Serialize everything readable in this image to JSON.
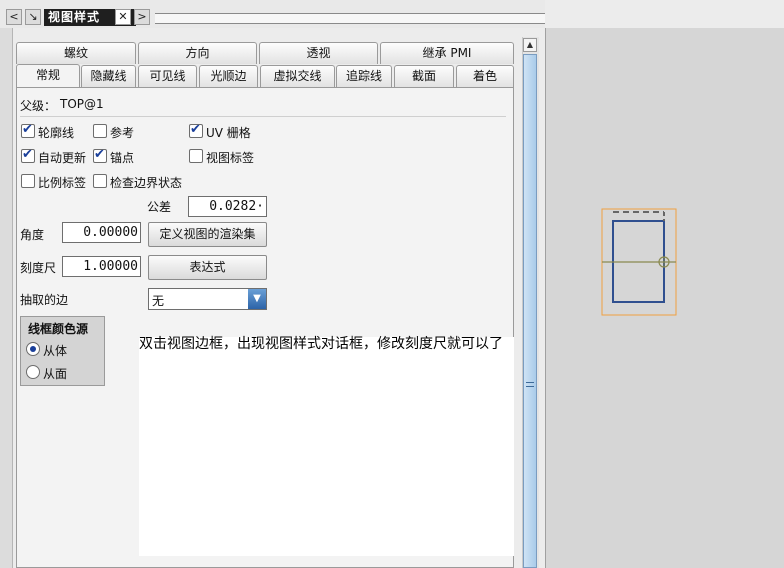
{
  "titlebar": {
    "title": "视图样式",
    "nav_left": "<",
    "nav_right": ">",
    "close": "✕",
    "pin": "↘"
  },
  "tabs_row1": [
    "螺纹",
    "方向",
    "透视",
    "继承 PMI"
  ],
  "tabs_row2": [
    "常规",
    "隐藏线",
    "可见线",
    "光顺边",
    "虚拟交线",
    "追踪线",
    "截面",
    "着色"
  ],
  "active_tab": "常规",
  "parent": {
    "label": "父级：",
    "value": "TOP@1"
  },
  "checkboxes": {
    "silhouette": {
      "label": "轮廓线",
      "checked": true
    },
    "reference": {
      "label": "参考",
      "checked": false
    },
    "uv_grid": {
      "label": "UV 栅格",
      "checked": true
    },
    "auto_update": {
      "label": "自动更新",
      "checked": true
    },
    "anchor": {
      "label": "锚点",
      "checked": true
    },
    "view_label": {
      "label": "视图标签",
      "checked": false
    },
    "scale_label": {
      "label": "比例标签",
      "checked": false
    },
    "check_boundary": {
      "label": "检查边界状态",
      "checked": false
    }
  },
  "tolerance": {
    "label": "公差",
    "value": "0.0282·"
  },
  "angle": {
    "label": "角度",
    "value": "0.00000"
  },
  "scale": {
    "label": "刻度尺",
    "value": "1.00000"
  },
  "buttons": {
    "define_render_set": "定义视图的渲染集",
    "expression": "表达式"
  },
  "extracted_edges": {
    "label": "抽取的边",
    "value": "无"
  },
  "wireframe_color": {
    "title": "线框颜色源",
    "option_body": "从体",
    "option_face": "从面",
    "selected": "从体"
  },
  "note": "双击视图边框，出现视图样式对话框，修改刻度尺就可以了",
  "colors": {
    "accent": "#1a3f9a",
    "drawing_border": "#f0a040",
    "view_line": "#2f4f8f",
    "axis_line": "#8a8a50"
  }
}
